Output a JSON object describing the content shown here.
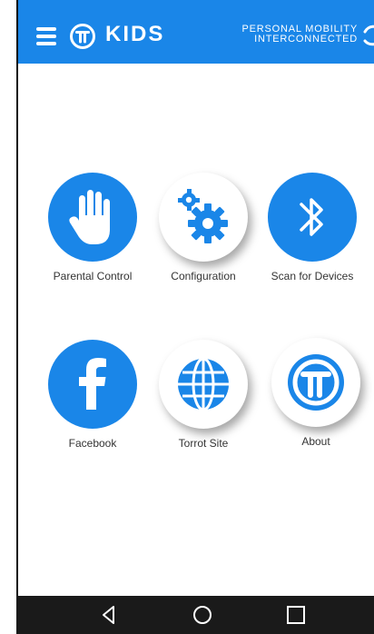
{
  "colors": {
    "accent": "#1a86e8",
    "navbar": "#1a1a1a",
    "text": "#333333"
  },
  "header": {
    "brand": "KIDS",
    "tagline_line1": "PERSONAL MOBILITY",
    "tagline_line2": "INTERCONNECTED",
    "icons": [
      "hamburger-menu-icon",
      "torrot-logo-icon",
      "sync-icon"
    ]
  },
  "tiles": [
    {
      "label": "Parental Control",
      "icon": "hand-icon",
      "style": "blue"
    },
    {
      "label": "Configuration",
      "icon": "gears-icon",
      "style": "white"
    },
    {
      "label": "Scan for Devices",
      "icon": "bluetooth-icon",
      "style": "blue"
    },
    {
      "label": "Facebook",
      "icon": "facebook-icon",
      "style": "blue"
    },
    {
      "label": "Torrot Site",
      "icon": "globe-icon",
      "style": "white"
    },
    {
      "label": "About",
      "icon": "torrot-logo-icon",
      "style": "white"
    }
  ],
  "navbar": {
    "icons": [
      "back-icon",
      "home-icon",
      "recents-icon"
    ]
  }
}
